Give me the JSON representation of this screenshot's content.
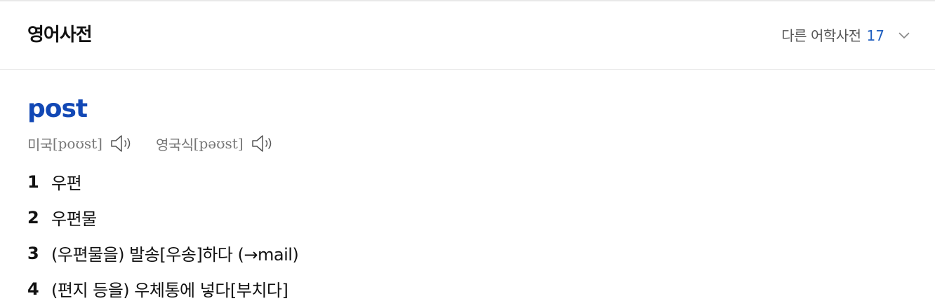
{
  "header": {
    "title": "영어사전",
    "other_dicts_label": "다른 어학사전",
    "other_dicts_count": "17"
  },
  "entry": {
    "headword": "post",
    "pronunciations": [
      {
        "region": "미국",
        "ipa": "[poʊst]",
        "icon": "speaker-icon"
      },
      {
        "region": "영국식",
        "ipa": "[pəʊst]",
        "icon": "speaker-icon"
      }
    ],
    "meanings": [
      {
        "num": "1",
        "text": "우편"
      },
      {
        "num": "2",
        "text": "우편물"
      },
      {
        "num": "3",
        "text": "(우편물을) 발송[우송]하다 (→mail)"
      },
      {
        "num": "4",
        "text": "(편지 등을) 우체통에 넣다[부치다]"
      }
    ]
  },
  "colors": {
    "headword": "#1248b5",
    "count": "#1f5fbf"
  }
}
